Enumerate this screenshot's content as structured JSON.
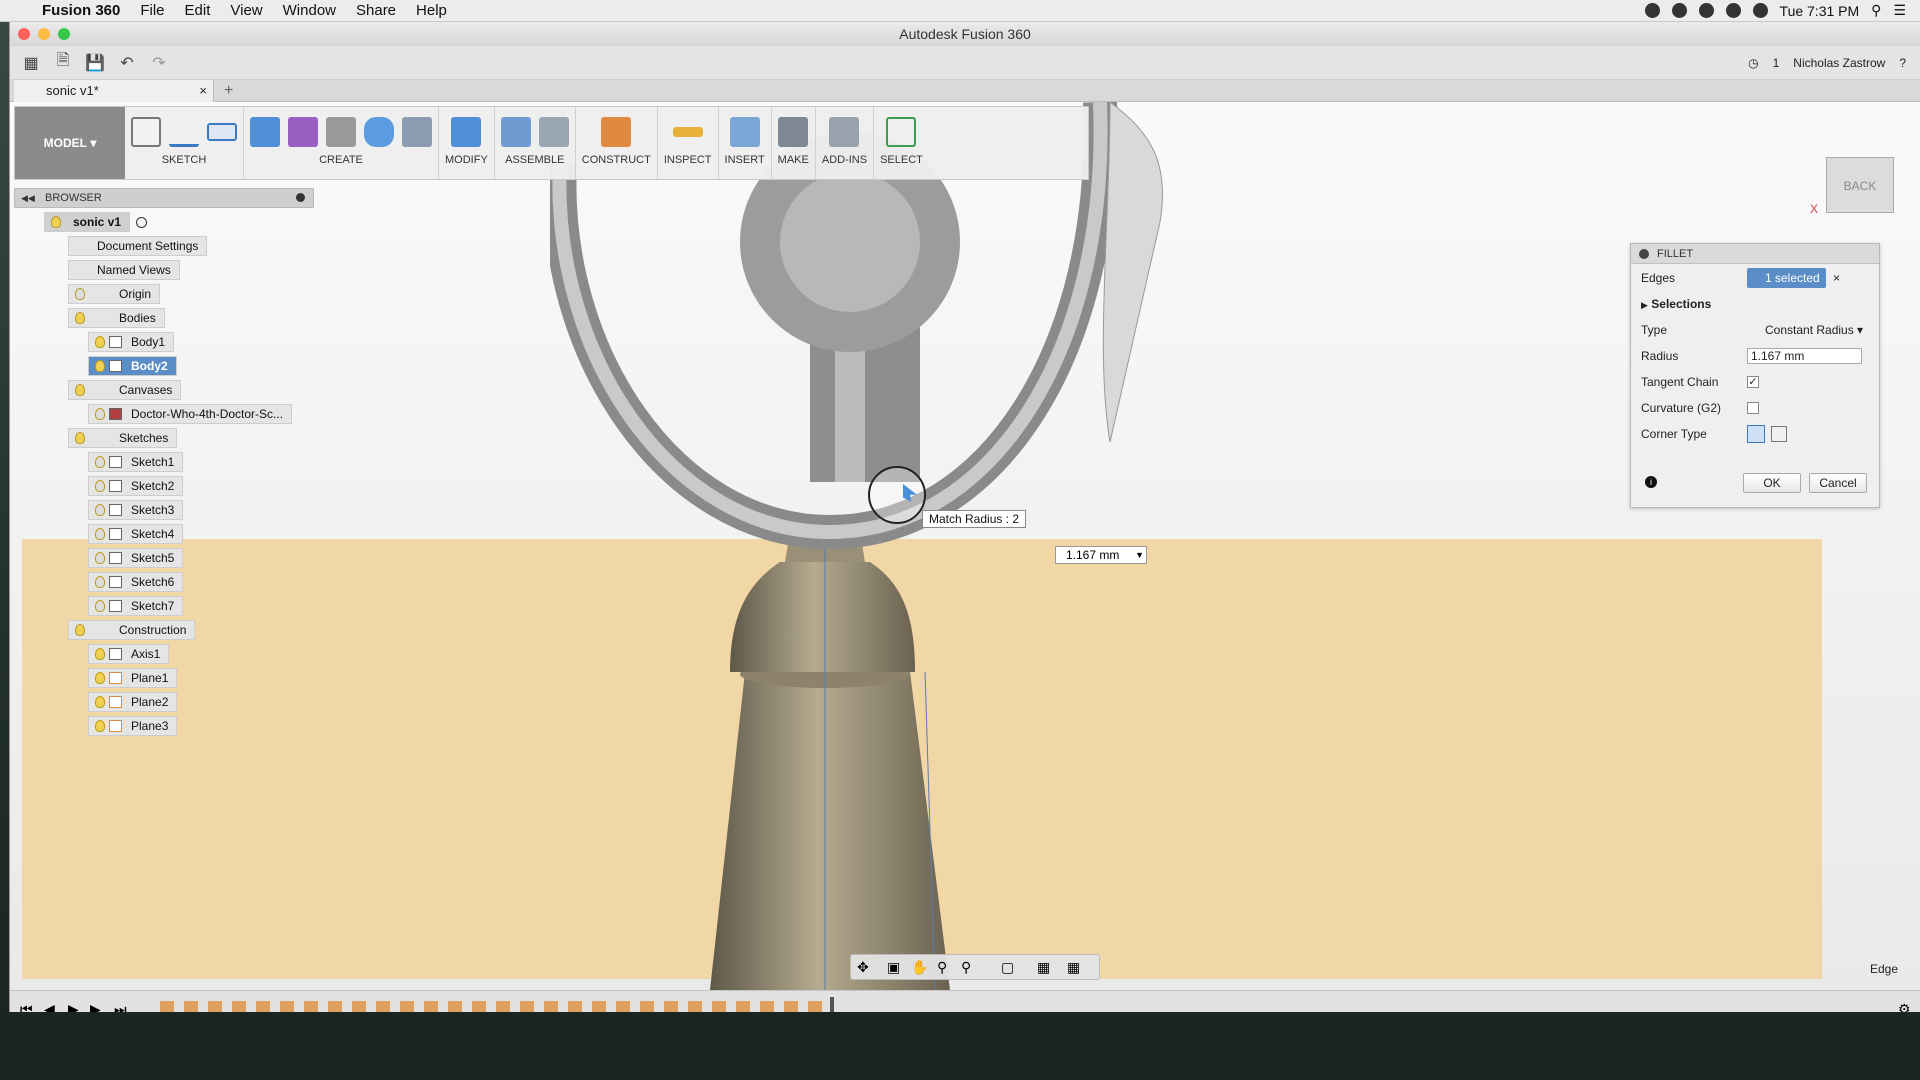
{
  "menubar": {
    "app_name": "Fusion 360",
    "items": [
      "File",
      "Edit",
      "View",
      "Window",
      "Share",
      "Help"
    ],
    "clock": "Tue 7:31 PM"
  },
  "window": {
    "title": "Autodesk Fusion 360"
  },
  "quick_access": {
    "jobs_count": "1",
    "user_name": "Nicholas Zastrow"
  },
  "document_tab": {
    "label": "sonic v1*"
  },
  "toolbar": {
    "workspace": "MODEL",
    "groups": [
      "SKETCH",
      "CREATE",
      "MODIFY",
      "ASSEMBLE",
      "CONSTRUCT",
      "INSPECT",
      "INSERT",
      "MAKE",
      "ADD-INS",
      "SELECT"
    ]
  },
  "browser": {
    "title": "BROWSER",
    "root": "sonic v1",
    "document_settings": "Document Settings",
    "named_views": "Named Views",
    "origin": "Origin",
    "bodies_folder": "Bodies",
    "bodies": [
      "Body1",
      "Body2"
    ],
    "canvases_folder": "Canvases",
    "canvases": [
      "Doctor-Who-4th-Doctor-Sc..."
    ],
    "sketches_folder": "Sketches",
    "sketches": [
      "Sketch1",
      "Sketch2",
      "Sketch3",
      "Sketch4",
      "Sketch5",
      "Sketch6",
      "Sketch7"
    ],
    "construction_folder": "Construction",
    "construction": [
      "Axis1",
      "Plane1",
      "Plane2",
      "Plane3"
    ]
  },
  "viewport": {
    "tooltip": "Match Radius : 2",
    "radius_input": "1.167 mm",
    "viewcube_label": "BACK",
    "selection_filter": "Edge"
  },
  "fillet": {
    "title": "FILLET",
    "edges_label": "Edges",
    "edges_value": "1 selected",
    "selections_label": "Selections",
    "type_label": "Type",
    "type_value": "Constant Radius",
    "radius_label": "Radius",
    "radius_value": "1.167 mm",
    "tangent_chain_label": "Tangent Chain",
    "tangent_chain": true,
    "curvature_label": "Curvature (G2)",
    "curvature": false,
    "corner_type_label": "Corner Type",
    "ok_label": "OK",
    "cancel_label": "Cancel"
  },
  "colors": {
    "selection_blue": "#5b8ec7",
    "ground": "#f1d6a6",
    "body": "#8a826e"
  }
}
